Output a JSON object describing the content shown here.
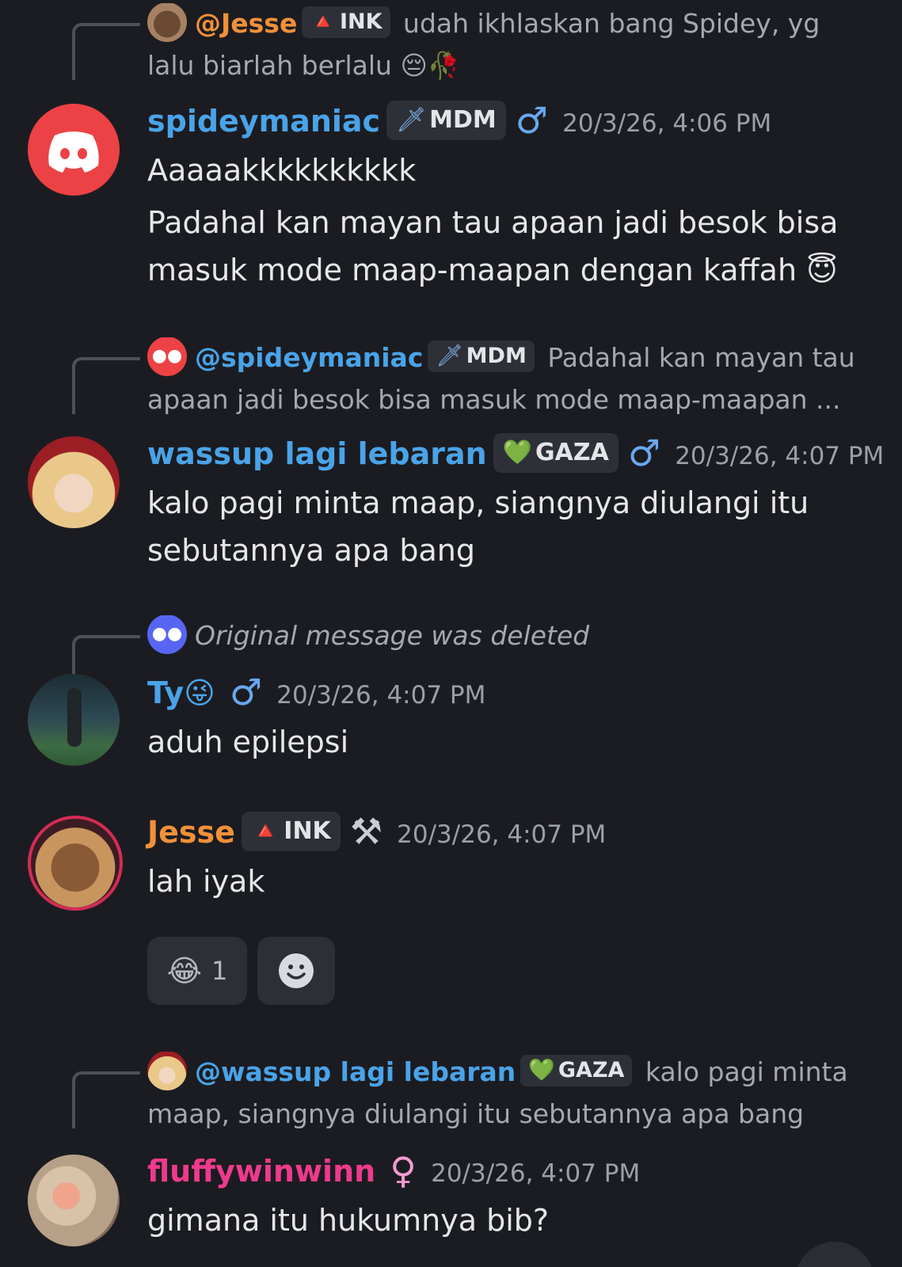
{
  "colors": {
    "background": "#1b1c21",
    "name_blue": "#4aa3e8",
    "name_orange": "#f0903a",
    "name_pink": "#ee3a8c",
    "gender_male": "#69a8ef",
    "gender_female": "#f19bd2",
    "discord_red": "#ec4245",
    "discord_blurple": "#5865f2"
  },
  "messages": [
    {
      "reply": {
        "author": "@Jesse",
        "tag_icon": "🔺",
        "tag": "INK",
        "text_line1": "udah ikhlaskan bang Spidey, yg",
        "text_line2": "lalu biarlah berlalu 😔🥀",
        "avatar_icon": "dog-avatar-icon"
      },
      "author": "spideymaniac",
      "tag_icon": "🗡",
      "tag": "MDM",
      "gender": "♂",
      "timestamp": "20/3/26, 4:06 PM",
      "body": [
        "Aaaaakkkkkkkkkk",
        "Padahal kan mayan tau apaan jadi besok bisa",
        "masuk mode maap-maapan dengan kaffah 😇"
      ],
      "avatar_icon": "discord-logo-icon"
    },
    {
      "reply": {
        "author": "@spideymaniac",
        "tag_icon": "🗡",
        "tag": "MDM",
        "text_line1": "Padahal kan mayan tau",
        "text_line2": "apaan jadi besok bisa masuk mode maap-maapan ...",
        "avatar_icon": "discord-logo-icon"
      },
      "author": "wassup lagi lebaran",
      "tag_icon": "💚",
      "tag": "GAZA",
      "gender": "♂",
      "timestamp": "20/3/26, 4:07 PM",
      "body": [
        "kalo pagi minta maap, siangnya diulangi itu",
        "sebutannya apa bang"
      ],
      "avatar_icon": "anime-avatar-icon"
    },
    {
      "reply": {
        "deleted_text": "Original message was deleted",
        "avatar_icon": "discord-logo-icon"
      },
      "author": "Ty",
      "author_emoji": "😜",
      "gender": "♂",
      "timestamp": "20/3/26, 4:07 PM",
      "body": [
        "aduh epilepsi"
      ],
      "avatar_icon": "photo-avatar-icon"
    },
    {
      "author": "Jesse",
      "tag_icon": "🔺",
      "tag": "INK",
      "role_icon": "⚒",
      "timestamp": "20/3/26, 4:07 PM",
      "body": [
        "lah iyak"
      ],
      "reactions": [
        {
          "emoji": "😂",
          "count": "1"
        }
      ],
      "add_reaction_icon": "add-reaction-icon",
      "avatar_icon": "dog-avatar-icon"
    },
    {
      "reply": {
        "author": "@wassup lagi lebaran",
        "tag_icon": "💚",
        "tag": "GAZA",
        "text_line1": "kalo pagi minta",
        "text_line2": "maap, siangnya diulangi itu sebutannya apa bang",
        "avatar_icon": "anime-avatar-icon"
      },
      "author": "fluffywinwinn",
      "gender": "♀",
      "timestamp": "20/3/26, 4:07 PM",
      "body": [
        "gimana itu hukumnya bib?"
      ],
      "avatar_icon": "flower-avatar-icon"
    }
  ]
}
